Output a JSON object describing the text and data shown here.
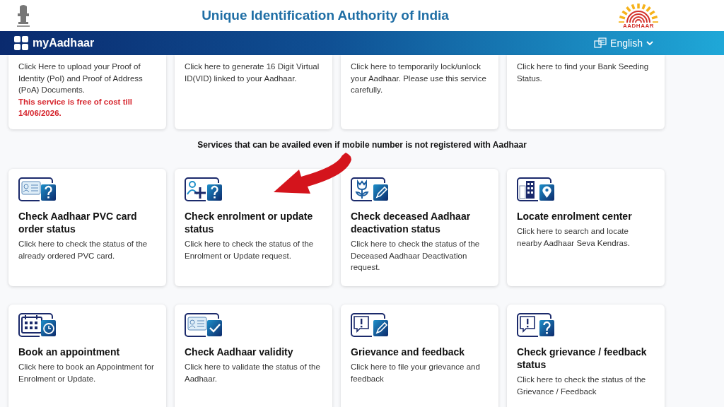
{
  "header": {
    "title": "Unique Identification Authority of India",
    "logo_text": "AADHAAR"
  },
  "navbar": {
    "brand": "myAadhaar",
    "language": "English"
  },
  "top_cards": [
    {
      "description": "Click Here to upload your Proof of Identity (PoI) and Proof of Address (PoA) Documents.",
      "note": "This service is free of cost till 14/06/2026."
    },
    {
      "description": "Click here to generate 16 Digit Virtual ID(VID) linked to your Aadhaar."
    },
    {
      "description": "Click here to temporarily lock/unlock your Aadhaar. Please use this service carefully."
    },
    {
      "description": "Click here to find your Bank Seeding Status."
    }
  ],
  "section_heading": "Services that can be availed even if mobile number is not registered with Aadhaar",
  "service_cards": [
    {
      "title": "Check Aadhaar PVC card order status",
      "description": "Click here to check the status of the already ordered PVC card."
    },
    {
      "title": "Check enrolment or update status",
      "description": "Click here to check the status of the Enrolment or Update request."
    },
    {
      "title": "Check deceased Aadhaar deactivation status",
      "description": "Click here to check the status of the Deceased Aadhaar Deactivation request."
    },
    {
      "title": "Locate enrolment center",
      "description": "Click here to search and locate nearby Aadhaar Seva Kendras."
    },
    {
      "title": "Book an appointment",
      "description": "Click here to book an Appointment for Enrolment or Update."
    },
    {
      "title": "Check Aadhaar validity",
      "description": "Click here to validate the status of the Aadhaar."
    },
    {
      "title": "Grievance and feedback",
      "description": "Click here to file your grievance and feedback"
    },
    {
      "title": "Check grievance / feedback status",
      "description": "Click here to check the status of the Grievance / Feedback"
    }
  ]
}
